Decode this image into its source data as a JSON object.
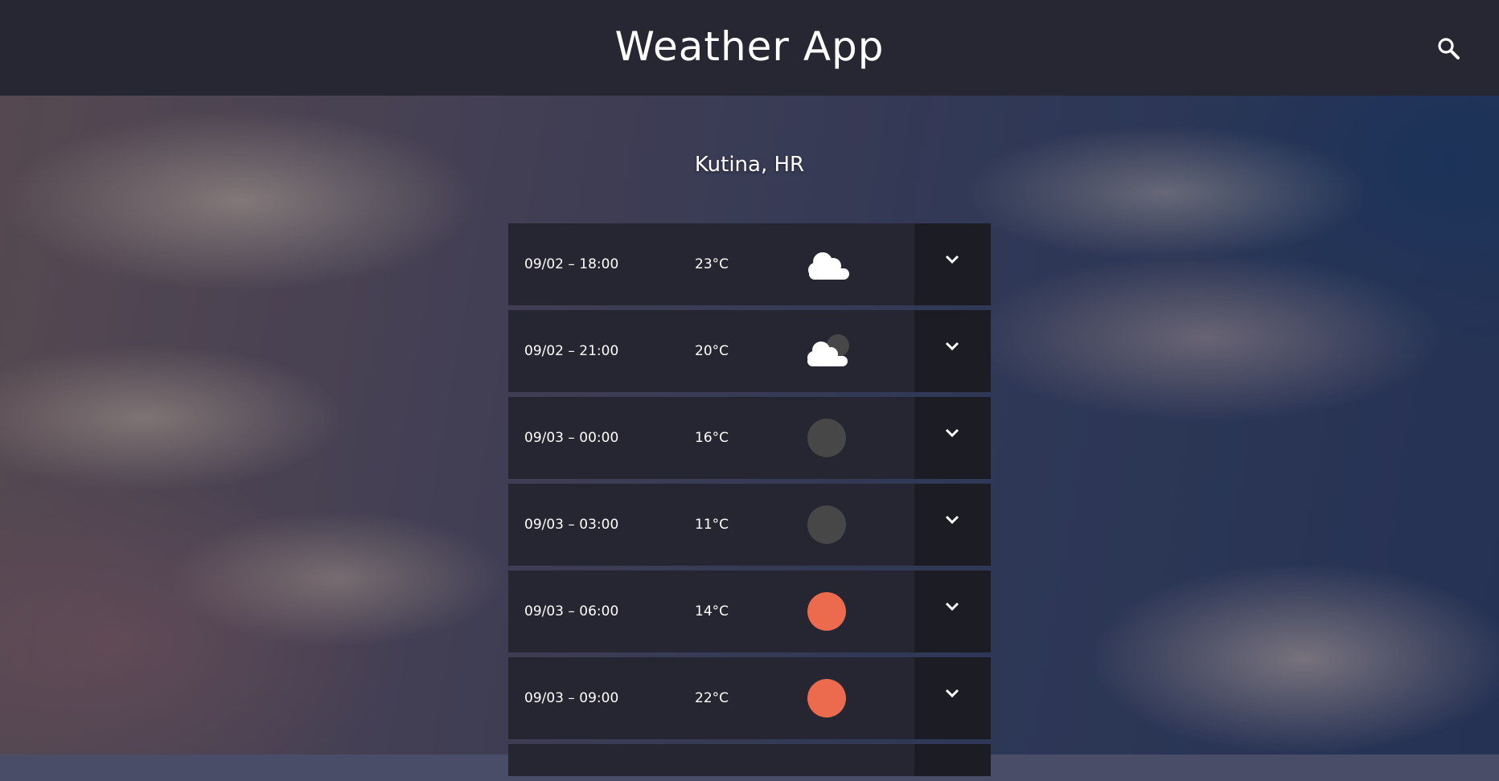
{
  "header": {
    "title": "Weather App",
    "search_icon": "search-icon"
  },
  "location": "Kutina, HR",
  "forecast": [
    {
      "time": "09/02 – 18:00",
      "temp": "23°C",
      "icon": "cloud-icon"
    },
    {
      "time": "09/02 – 21:00",
      "temp": "20°C",
      "icon": "cloud-moon-icon"
    },
    {
      "time": "09/03 – 00:00",
      "temp": "16°C",
      "icon": "moon-icon"
    },
    {
      "time": "09/03 – 03:00",
      "temp": "11°C",
      "icon": "moon-icon"
    },
    {
      "time": "09/03 – 06:00",
      "temp": "14°C",
      "icon": "sun-icon"
    },
    {
      "time": "09/03 – 09:00",
      "temp": "22°C",
      "icon": "sun-icon"
    }
  ],
  "colors": {
    "header_bg": "#272733",
    "row_bg": "#262632",
    "toggle_bg": "#1c1c25",
    "sun": "#ec6b4e",
    "moon": "#474747",
    "cloud": "#ffffff"
  }
}
